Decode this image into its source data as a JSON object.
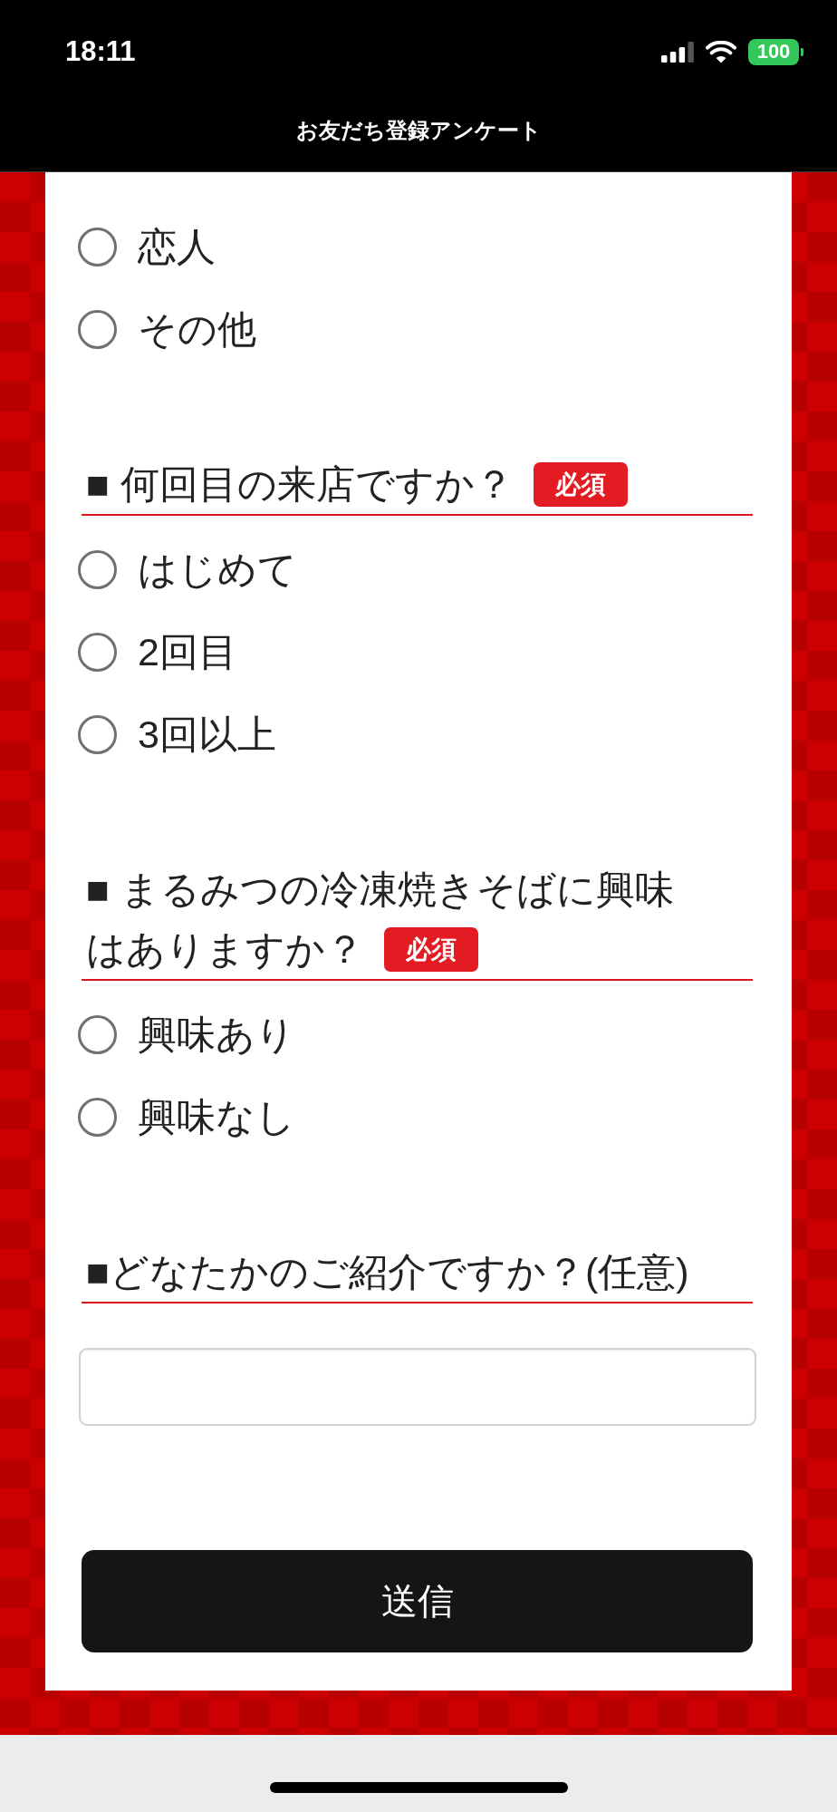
{
  "status_bar": {
    "time": "18:11",
    "battery": "100"
  },
  "header": {
    "title": "お友だち登録アンケート"
  },
  "form": {
    "questions": [
      {
        "kind": "choice",
        "options": [
          {
            "label": "恋人",
            "selected": false
          },
          {
            "label": "その他",
            "selected": false
          }
        ]
      },
      {
        "kind": "choice",
        "title": "■ 何回目の来店ですか？",
        "badge": "必須",
        "options": [
          {
            "label": "はじめて",
            "selected": false
          },
          {
            "label": "2回目",
            "selected": false
          },
          {
            "label": "3回以上",
            "selected": false
          }
        ]
      },
      {
        "kind": "choice",
        "title": "■ まるみつの冷凍焼きそばに興味はありますか？",
        "badge": "必須",
        "options": [
          {
            "label": "興味あり",
            "selected": false
          },
          {
            "label": "興味なし",
            "selected": false
          }
        ]
      },
      {
        "kind": "text",
        "title": "■どなたかのご紹介ですか？(任意)"
      }
    ],
    "submit_label": "送信"
  }
}
